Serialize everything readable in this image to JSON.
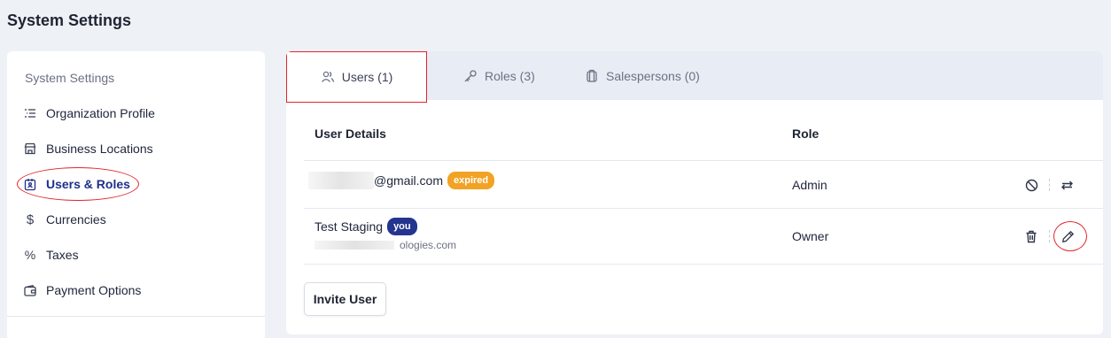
{
  "page": {
    "title": "System Settings"
  },
  "sidebar": {
    "heading": "System Settings",
    "items": [
      {
        "label": "Organization Profile",
        "icon": "list-icon"
      },
      {
        "label": "Business Locations",
        "icon": "store-icon"
      },
      {
        "label": "Users & Roles",
        "icon": "user-badge-icon",
        "active": true
      },
      {
        "label": "Currencies",
        "icon": "dollar-icon"
      },
      {
        "label": "Taxes",
        "icon": "percent-icon"
      },
      {
        "label": "Payment Options",
        "icon": "wallet-icon"
      }
    ]
  },
  "tabs": [
    {
      "label": "Users (1)",
      "icon": "users-icon",
      "active": true
    },
    {
      "label": "Roles (3)",
      "icon": "key-icon"
    },
    {
      "label": "Salespersons (0)",
      "icon": "briefcase-icon"
    }
  ],
  "table": {
    "headers": {
      "user": "User Details",
      "role": "Role"
    },
    "rows": [
      {
        "email_suffix": "@gmail.com",
        "badge": "expired",
        "role": "Admin",
        "actions": [
          "ban-icon",
          "swap-icon"
        ]
      },
      {
        "name": "Test Staging",
        "badge": "you",
        "email_suffix": "ologies.com",
        "role": "Owner",
        "actions": [
          "trash-icon",
          "pencil-icon"
        ]
      }
    ]
  },
  "invite_button": "Invite User",
  "colors": {
    "accent": "#1e2f8a",
    "badge_expired": "#f2a224",
    "badge_you": "#24358f",
    "highlight": "#e3232b"
  }
}
